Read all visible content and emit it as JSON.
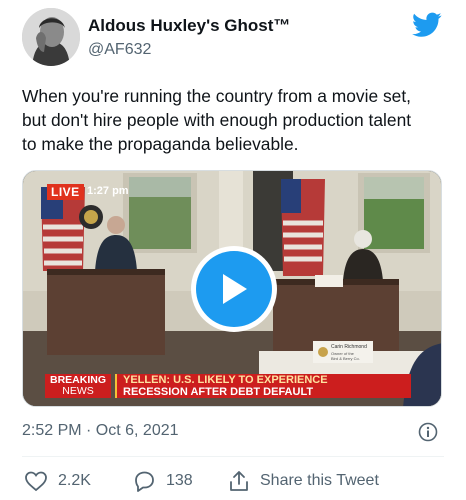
{
  "author": {
    "display_name": "Aldous Huxley's Ghost™",
    "handle": "@AF632"
  },
  "tweet": {
    "line1": "When you're running the country from a movie set,",
    "line2": "but don't hire people with enough production talent",
    "line3": "to make the propaganda believable.",
    "timestamp": "2:52 PM · Oct 6, 2021"
  },
  "video": {
    "live_label": "LIVE",
    "live_time": "1:27 pm",
    "breaking_line1": "BREAKING",
    "breaking_line2": "NEWS",
    "headline_line1": "YELLEN: U.S. LIKELY TO EXPERIENCE",
    "headline_line2": "RECESSION AFTER DEBT DEFAULT",
    "nameplate_line1": "Carin Richmond",
    "nameplate_line2": "Owner of the",
    "nameplate_line3": "Bird & Berry Co."
  },
  "actions": {
    "likes": "2.2K",
    "replies": "138",
    "share_label": "Share this Tweet"
  },
  "colors": {
    "brand_blue": "#1d9bf0",
    "secondary_text": "#536471",
    "breaking_red": "#cc1e1e"
  }
}
